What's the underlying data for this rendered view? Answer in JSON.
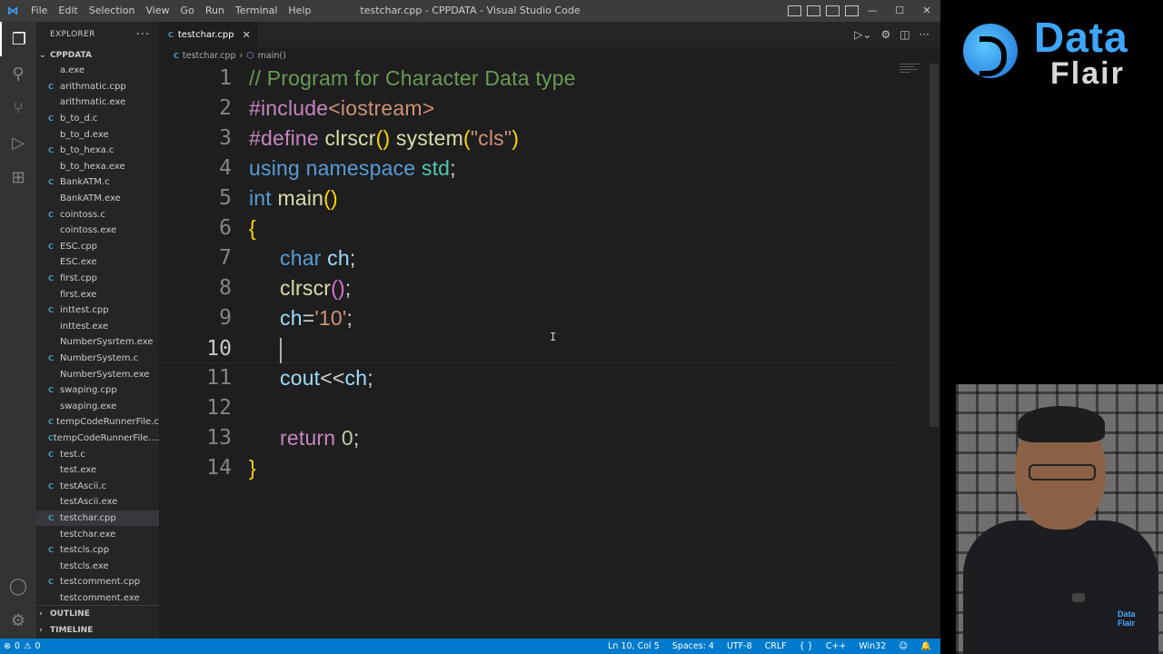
{
  "titlebar": {
    "app_icon": "vscode-logo-icon",
    "menu": [
      "File",
      "Edit",
      "Selection",
      "View",
      "Go",
      "Run",
      "Terminal",
      "Help"
    ],
    "title": "testchar.cpp - CPPDATA - Visual Studio Code",
    "window_controls": {
      "minimize": "—",
      "maximize": "☐",
      "close": "✕"
    }
  },
  "activity_bar": {
    "items": [
      "explorer-icon",
      "search-icon",
      "source-control-icon",
      "run-debug-icon",
      "extensions-icon"
    ],
    "bottom": [
      "account-icon",
      "settings-gear-icon"
    ]
  },
  "sidebar": {
    "header": "EXPLORER",
    "more": "···",
    "folder": "CPPDATA",
    "files": [
      {
        "name": "a.exe",
        "type": "exe"
      },
      {
        "name": "arithmatic.cpp",
        "type": "cpp"
      },
      {
        "name": "arithmatic.exe",
        "type": "exe"
      },
      {
        "name": "b_to_d.c",
        "type": "c"
      },
      {
        "name": "b_to_d.exe",
        "type": "exe"
      },
      {
        "name": "b_to_hexa.c",
        "type": "c"
      },
      {
        "name": "b_to_hexa.exe",
        "type": "exe"
      },
      {
        "name": "BankATM.c",
        "type": "c"
      },
      {
        "name": "BankATM.exe",
        "type": "exe"
      },
      {
        "name": "cointoss.c",
        "type": "c"
      },
      {
        "name": "cointoss.exe",
        "type": "exe"
      },
      {
        "name": "ESC.cpp",
        "type": "cpp"
      },
      {
        "name": "ESC.exe",
        "type": "exe"
      },
      {
        "name": "first.cpp",
        "type": "cpp"
      },
      {
        "name": "first.exe",
        "type": "exe"
      },
      {
        "name": "inttest.cpp",
        "type": "cpp"
      },
      {
        "name": "inttest.exe",
        "type": "exe"
      },
      {
        "name": "NumberSysrtem.exe",
        "type": "exe"
      },
      {
        "name": "NumberSystem.c",
        "type": "c"
      },
      {
        "name": "NumberSystem.exe",
        "type": "exe"
      },
      {
        "name": "swaping.cpp",
        "type": "cpp"
      },
      {
        "name": "swaping.exe",
        "type": "exe"
      },
      {
        "name": "tempCodeRunnerFile.c",
        "type": "c"
      },
      {
        "name": "tempCodeRunnerFile....",
        "type": "cpp"
      },
      {
        "name": "test.c",
        "type": "c"
      },
      {
        "name": "test.exe",
        "type": "exe"
      },
      {
        "name": "testAscii.c",
        "type": "c"
      },
      {
        "name": "testAscii.exe",
        "type": "exe"
      },
      {
        "name": "testchar.cpp",
        "type": "cpp",
        "selected": true
      },
      {
        "name": "testchar.exe",
        "type": "exe"
      },
      {
        "name": "testcls.cpp",
        "type": "cpp"
      },
      {
        "name": "testcls.exe",
        "type": "exe"
      },
      {
        "name": "testcomment.cpp",
        "type": "cpp"
      },
      {
        "name": "testcomment.exe",
        "type": "exe"
      }
    ],
    "outline": "OUTLINE",
    "timeline": "TIMELINE"
  },
  "editor": {
    "tab": {
      "label": "testchar.cpp",
      "close": "✕"
    },
    "breadcrumb": {
      "file": "testchar.cpp",
      "separator": "›",
      "symbol": "main()"
    },
    "current_line": 10,
    "lines": [
      {
        "n": "1",
        "tokens": [
          [
            "tk-comment",
            "// Program for Character Data type"
          ]
        ]
      },
      {
        "n": "2",
        "tokens": [
          [
            "tk-pp",
            "#include"
          ],
          [
            "tk-inc",
            "<iostream>"
          ]
        ]
      },
      {
        "n": "3",
        "tokens": [
          [
            "tk-pp",
            "#define "
          ],
          [
            "tk-fn",
            "clrscr"
          ],
          [
            "tk-brace",
            "()"
          ],
          [
            "tk-plain",
            " "
          ],
          [
            "tk-fn",
            "system"
          ],
          [
            "tk-brace",
            "("
          ],
          [
            "tk-str",
            "\"cls\""
          ],
          [
            "tk-brace",
            ")"
          ]
        ]
      },
      {
        "n": "4",
        "tokens": [
          [
            "tk-kw",
            "using namespace "
          ],
          [
            "tk-ns",
            "std"
          ],
          [
            "tk-plain",
            ";"
          ]
        ]
      },
      {
        "n": "5",
        "tokens": [
          [
            "tk-kw",
            "int "
          ],
          [
            "tk-fn",
            "main"
          ],
          [
            "tk-brace",
            "()"
          ]
        ]
      },
      {
        "n": "6",
        "tokens": [
          [
            "tk-brace",
            "{"
          ]
        ]
      },
      {
        "n": "7",
        "indent": true,
        "tokens": [
          [
            "tk-kw",
            "char "
          ],
          [
            "tk-var",
            "ch"
          ],
          [
            "tk-plain",
            ";"
          ]
        ]
      },
      {
        "n": "8",
        "indent": true,
        "tokens": [
          [
            "tk-fn",
            "clrscr"
          ],
          [
            "tk-paren",
            "()"
          ],
          [
            "tk-plain",
            ";"
          ]
        ]
      },
      {
        "n": "9",
        "indent": true,
        "tokens": [
          [
            "tk-var",
            "ch"
          ],
          [
            "tk-plain",
            "="
          ],
          [
            "tk-str",
            "'10'"
          ],
          [
            "tk-plain",
            ";"
          ]
        ]
      },
      {
        "n": "10",
        "indent": true,
        "cursor": true,
        "tokens": []
      },
      {
        "n": "11",
        "indent": true,
        "tokens": [
          [
            "tk-var",
            "cout"
          ],
          [
            "tk-plain",
            "<<"
          ],
          [
            "tk-var",
            "ch"
          ],
          [
            "tk-plain",
            ";"
          ]
        ]
      },
      {
        "n": "12",
        "tokens": []
      },
      {
        "n": "13",
        "indent": true,
        "tokens": [
          [
            "tk-ctrl",
            "return "
          ],
          [
            "tk-num",
            "0"
          ],
          [
            "tk-plain",
            ";"
          ]
        ]
      },
      {
        "n": "14",
        "tokens": [
          [
            "tk-brace",
            "}"
          ]
        ]
      }
    ]
  },
  "statusbar": {
    "errors": "0",
    "warnings": "0",
    "position": "Ln 10, Col 5",
    "spaces": "Spaces: 4",
    "encoding": "UTF-8",
    "eol": "CRLF",
    "language": "C++",
    "platform": "Win32"
  },
  "brand": {
    "word1": "Data",
    "word2": "Flair"
  },
  "webcam": {
    "badge": "Data Flair"
  }
}
